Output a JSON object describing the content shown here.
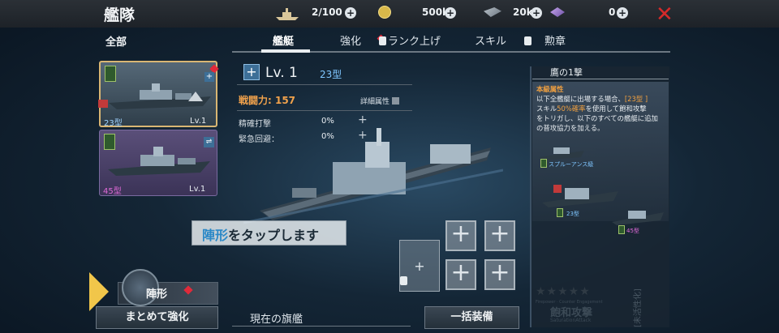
{
  "header": {
    "title": "艦隊",
    "resources": [
      {
        "icon": "ship-count-icon",
        "value": "2/100"
      },
      {
        "icon": "gold-coin-icon",
        "value": "500k"
      },
      {
        "icon": "steel-icon",
        "value": "20k"
      },
      {
        "icon": "crystal-icon",
        "value": "0"
      }
    ]
  },
  "filter_label": "全部",
  "tabs": [
    {
      "label": "艦艇",
      "active": true
    },
    {
      "label": "強化",
      "active": false
    },
    {
      "label": "ランク上げ",
      "active": false,
      "locked": true
    },
    {
      "label": "スキル",
      "active": false
    },
    {
      "label": "勲章",
      "active": false,
      "locked": true
    }
  ],
  "ships": [
    {
      "type": "23型",
      "level": "Lv.1",
      "selected": true
    },
    {
      "type": "45型",
      "level": "Lv.1",
      "selected": false
    }
  ],
  "stats": {
    "level": "Lv. 1",
    "ship_type": "23型",
    "power_label": "戦闘力: 157",
    "detail_label": "詳細属性",
    "rows": [
      {
        "label": "精確打撃",
        "value": "0%"
      },
      {
        "label": "緊急回避：",
        "value": "0%"
      }
    ]
  },
  "hint": {
    "highlight": "陣形",
    "rest": "をタップします"
  },
  "skill": {
    "title": "鷹の1撃",
    "heading": "本級属性",
    "line1a": "以下全艦艇に出場する場合、",
    "line1b": "[23型  ]",
    "line2a": "スキル",
    "line2b": "50%確率",
    "line2c": "を使用して飽和攻撃",
    "line3": "をトリガし、以下のすべての艦艇に追加",
    "line4": "の普攻協力を加える。",
    "ships": [
      "スプルーアンス級",
      "23型",
      "45型"
    ],
    "stars": "★★★★★",
    "badge_top": "Firepower · Counter Engagement",
    "badge_main": "飽和攻撃",
    "badge_sub": "SaturationAttack",
    "status": "[未活性化]"
  },
  "bottom": {
    "formation_label": "陣形",
    "bulk_enhance": "まとめて強化",
    "flagship": "現在の旗艦",
    "equip_all": "一括装備"
  },
  "colors": {
    "accent_orange": "#f1a24c",
    "highlight_blue": "#2a88c7",
    "close_red": "#d62a2a"
  }
}
